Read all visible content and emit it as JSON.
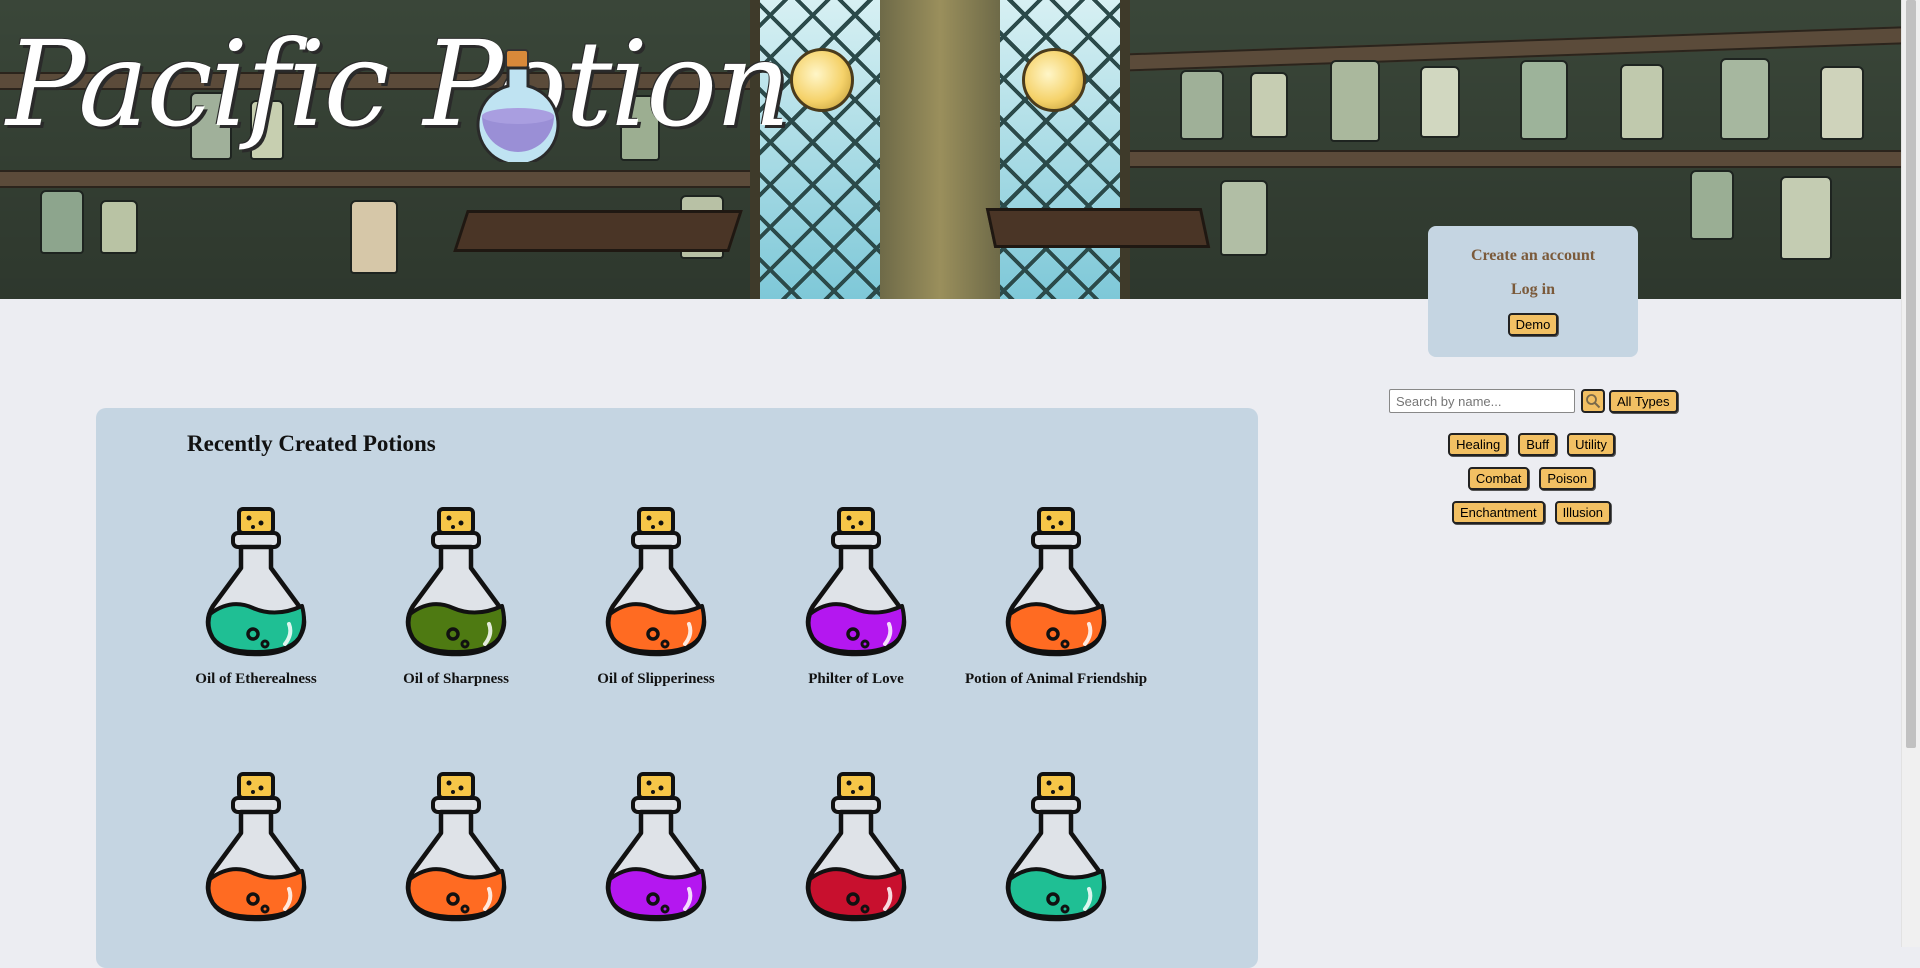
{
  "logo": {
    "text": "Pacific Potion"
  },
  "auth": {
    "create_account": "Create an account",
    "log_in": "Log in",
    "demo": "Demo"
  },
  "search": {
    "placeholder": "Search by name...",
    "all_types": "All Types"
  },
  "filters": {
    "row1": [
      "Healing",
      "Buff",
      "Utility"
    ],
    "row2": [
      "Combat",
      "Poison"
    ],
    "row3": [
      "Enchantment",
      "Illusion"
    ]
  },
  "main": {
    "title": "Recently Created Potions",
    "potions": [
      {
        "name": "Oil of Etherealness",
        "color": "#1fbf94"
      },
      {
        "name": "Oil of Sharpness",
        "color": "#4e7a12"
      },
      {
        "name": "Oil of Slipperiness",
        "color": "#ff6b22"
      },
      {
        "name": "Philter of Love",
        "color": "#b417f0"
      },
      {
        "name": "Potion of Animal Friendship",
        "color": "#ff6b22"
      },
      {
        "name": "",
        "color": "#ff6b22"
      },
      {
        "name": "",
        "color": "#ff6b22"
      },
      {
        "name": "",
        "color": "#b417f0"
      },
      {
        "name": "",
        "color": "#c8102e"
      },
      {
        "name": "",
        "color": "#1fbf94"
      }
    ]
  }
}
